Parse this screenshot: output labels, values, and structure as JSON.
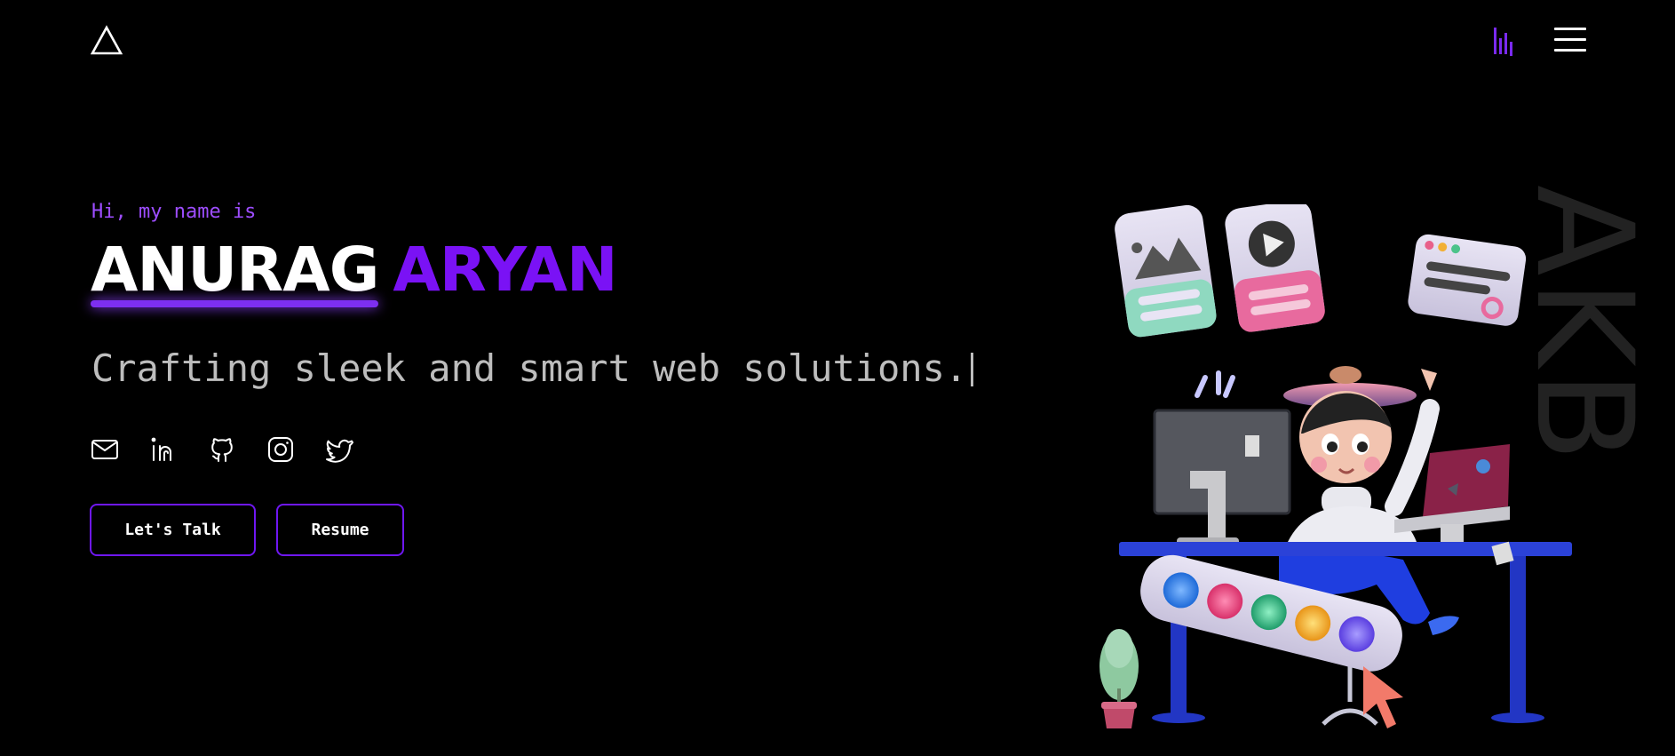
{
  "header": {
    "logo_icon": "triangle-logo-icon",
    "audio_icon": "equalizer-bars-icon",
    "menu_icon": "hamburger-menu-icon"
  },
  "hero": {
    "greeting": "Hi, my name is",
    "first_name": "ANURAG",
    "last_name": "ARYAN",
    "tagline": "Crafting sleek and smart web solutions.",
    "monogram": "AKB"
  },
  "socials": [
    {
      "icon": "mail-icon"
    },
    {
      "icon": "linkedin-icon"
    },
    {
      "icon": "github-icon"
    },
    {
      "icon": "instagram-icon"
    },
    {
      "icon": "twitter-icon"
    }
  ],
  "buttons": {
    "talk": "Let's Talk",
    "resume": "Resume"
  },
  "colors": {
    "background": "#000000",
    "accent": "#7a12f5",
    "greeting": "#9d4dff",
    "tagline": "#bdbdbd"
  }
}
